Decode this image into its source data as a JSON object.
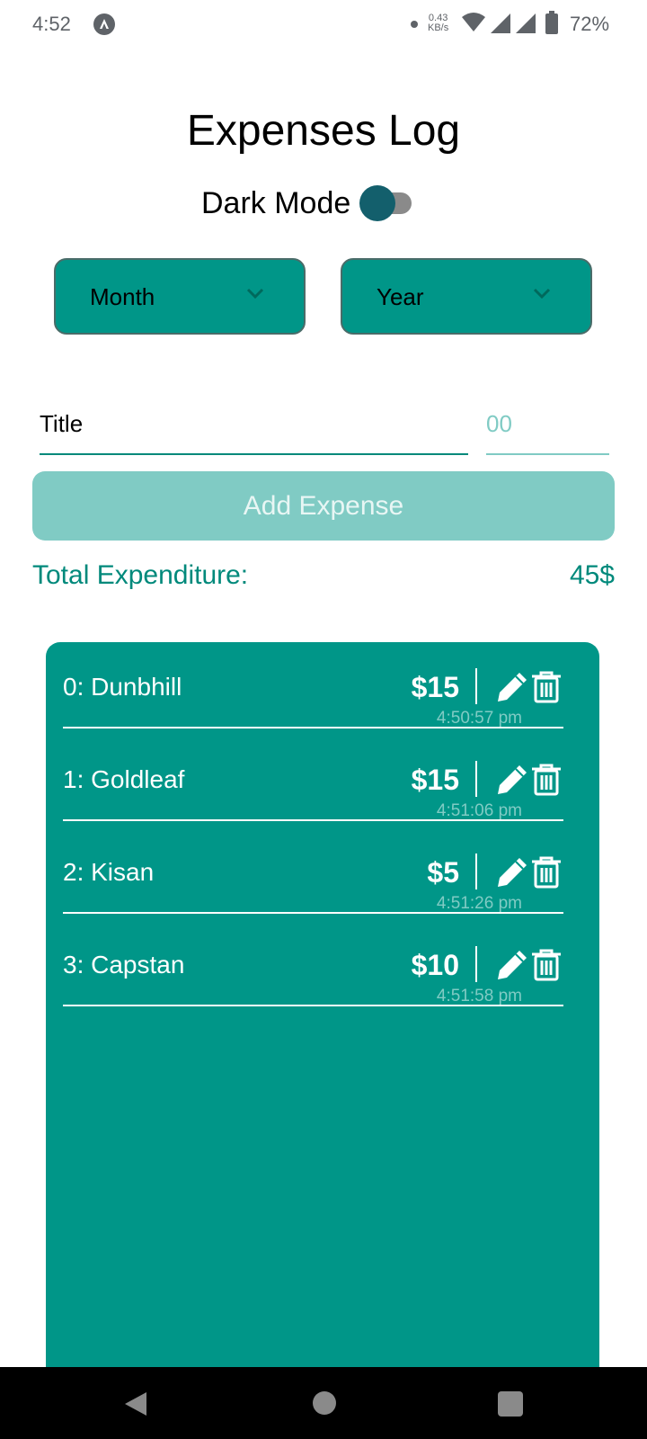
{
  "status_bar": {
    "time": "4:52",
    "speed_value": "0.43",
    "speed_unit": "KB/s",
    "battery": "72%"
  },
  "app": {
    "title": "Expenses Log",
    "dark_mode_label": "Dark Mode",
    "dark_mode_on": false
  },
  "filters": {
    "month_label": "Month",
    "year_label": "Year"
  },
  "form": {
    "title_placeholder": "Title",
    "amount_placeholder": "00",
    "add_button_label": "Add Expense"
  },
  "summary": {
    "total_label": "Total Expenditure:",
    "total_value": "45$"
  },
  "expenses": [
    {
      "name": "0: Dunbhill",
      "amount": "$15",
      "time": "4:50:57 pm"
    },
    {
      "name": "1: Goldleaf",
      "amount": "$15",
      "time": "4:51:06 pm"
    },
    {
      "name": "2: Kisan",
      "amount": "$5",
      "time": "4:51:26 pm"
    },
    {
      "name": "3: Capstan",
      "amount": "$10",
      "time": "4:51:58 pm"
    }
  ],
  "icons": {
    "status_app": "app-logo-icon",
    "wifi": "wifi-icon",
    "signal": "signal-icon",
    "battery": "battery-icon",
    "chevron": "chevron-down-icon",
    "edit": "pencil-icon",
    "delete": "trash-icon"
  },
  "colors": {
    "accent": "#009688",
    "accent_light": "#80cbc4",
    "toggle_thumb": "#135f6c"
  }
}
